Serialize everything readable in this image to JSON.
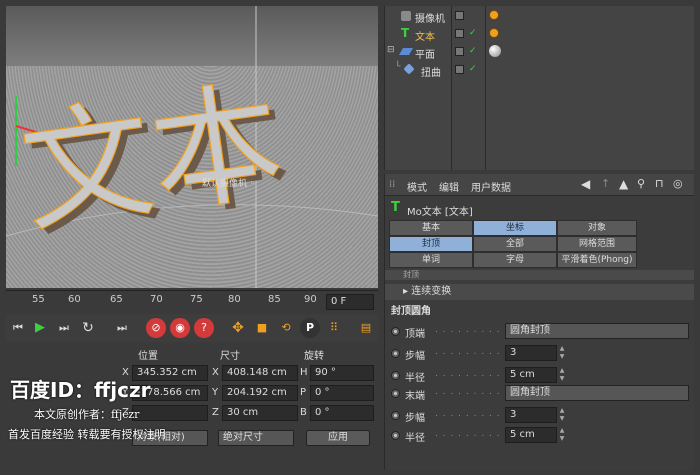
{
  "objects": [
    {
      "name": "摄像机",
      "icon": "camera-icon"
    },
    {
      "name": "文本",
      "icon": "text-object-icon"
    },
    {
      "name": "平面",
      "icon": "plane-object-icon"
    },
    {
      "name": "扭曲",
      "icon": "twist-deformer-icon"
    }
  ],
  "attribute_manager": {
    "menu": [
      "模式",
      "编辑",
      "用户数据"
    ],
    "object_title": "Mo文本 [文本]",
    "tabs": [
      {
        "label": "基本",
        "active": false
      },
      {
        "label": "坐标",
        "active": true
      },
      {
        "label": "对象",
        "active": false
      },
      {
        "label": "封顶",
        "active": true
      },
      {
        "label": "全部",
        "active": false
      },
      {
        "label": "网格范围",
        "active": false
      },
      {
        "label": "单词",
        "active": false
      },
      {
        "label": "字母",
        "active": false
      },
      {
        "label": "平滑着色(Phong)",
        "active": false
      }
    ],
    "partial_section": "封顶",
    "section_1": "▸ 连续变换",
    "section_2": "封顶圆角",
    "params": [
      {
        "label": "顶端",
        "value": "圆角封顶",
        "kind": "dropdown"
      },
      {
        "label": "步幅",
        "value": "3",
        "kind": "number"
      },
      {
        "label": "半径",
        "value": "5 cm",
        "kind": "number"
      },
      {
        "label": "末端",
        "value": "圆角封顶",
        "kind": "dropdown"
      },
      {
        "label": "步幅",
        "value": "3",
        "kind": "number"
      },
      {
        "label": "半径",
        "value": "5 cm",
        "kind": "number"
      }
    ]
  },
  "viewport": {
    "text": "文本",
    "hud_label": "默认摄像机 ◦"
  },
  "timeline": {
    "ticks": [
      "55",
      "60",
      "65",
      "70",
      "75",
      "80",
      "85",
      "90"
    ],
    "frame_field": "0 F"
  },
  "coordinates": {
    "headers": {
      "position": "位置",
      "size": "尺寸",
      "rotation": "旋转"
    },
    "rows": [
      {
        "axis": "X",
        "pos": "345.352 cm",
        "size_axis": "X",
        "size": "408.148 cm",
        "rot_axis": "H",
        "rot": "90 °"
      },
      {
        "axis": "Y",
        "pos": "-178.566 cm",
        "size_axis": "Y",
        "size": "204.192 cm",
        "rot_axis": "P",
        "rot": "0 °"
      },
      {
        "axis": "Z",
        "pos": "",
        "size_axis": "Z",
        "size": "30 cm",
        "rot_axis": "B",
        "rot": "0 °"
      }
    ],
    "mode_object": "对象(相对)",
    "mode_size": "绝对尺寸",
    "apply": "应用"
  },
  "watermark": {
    "baidu_id": "百度ID：ffjczr",
    "line1": "本文原创作者：ffjczr",
    "line2": "首发百度经验  转载要有授权注明"
  },
  "colors": {
    "accent_blue": "#8fb0d8",
    "play_green": "#3fcf3f",
    "record_red": "#d43a3a",
    "orange": "#f0a020"
  }
}
